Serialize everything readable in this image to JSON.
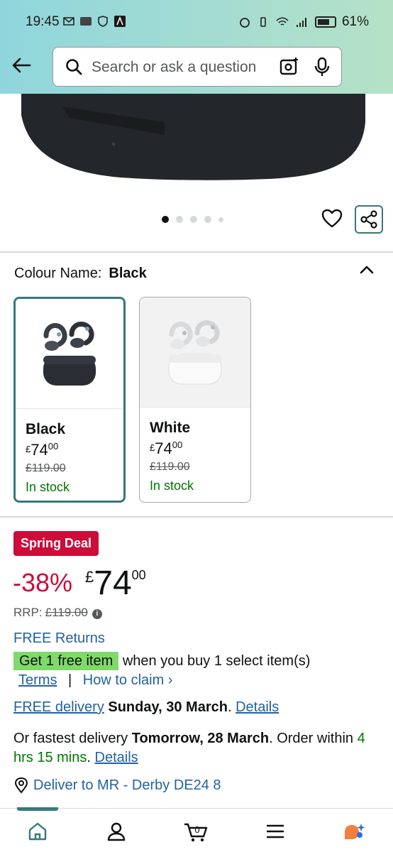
{
  "status_bar": {
    "time": "19:45",
    "battery": "61%"
  },
  "search": {
    "placeholder": "Search or ask a question"
  },
  "colour": {
    "label": "Colour Name:",
    "selected": "Black",
    "options": [
      {
        "name": "Black",
        "price_whole": "74",
        "price_fraction": "00",
        "currency": "£",
        "rrp": "£119.00",
        "stock": "In stock"
      },
      {
        "name": "White",
        "price_whole": "74",
        "price_fraction": "00",
        "currency": "£",
        "rrp": "£119.00",
        "stock": "In stock"
      }
    ]
  },
  "deal": {
    "badge": "Spring Deal",
    "discount": "-38%",
    "currency": "£",
    "price_whole": "74",
    "price_fraction": "00",
    "rrp_label": "RRP:",
    "rrp_value": "£119.00"
  },
  "returns": "FREE Returns",
  "offer": {
    "tag": "Get 1 free item",
    "text": " when you buy 1 select item(s)",
    "terms": "Terms",
    "separator": "|",
    "how_to_claim": "How to claim ›"
  },
  "delivery": {
    "free_delivery": "FREE delivery",
    "date": "Sunday, 30 March",
    "period": ".",
    "details": "Details"
  },
  "fastest": {
    "prefix": "Or fastest delivery ",
    "date": "Tomorrow, 28 March",
    "middle": ". Order within",
    "countdown": "4 hrs 15 mins",
    "period": ".",
    "details": "Details"
  },
  "deliver_to": "Deliver to MR - Derby DE24 8",
  "colors": {
    "accent_teal": "#37787f",
    "deal_red": "#cc0c39",
    "link_blue": "#2162a1",
    "stock_green": "#007600",
    "offer_green": "#7fda69"
  }
}
